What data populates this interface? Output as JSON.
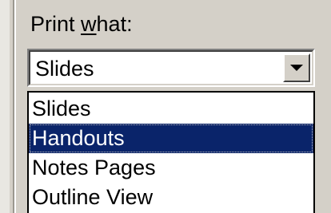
{
  "label": {
    "before": "Print ",
    "accel": "w",
    "after": "hat:"
  },
  "combo": {
    "selected_value": "Slides",
    "button_icon": "chevron-down-icon"
  },
  "dropdown": {
    "items": [
      {
        "label": "Slides",
        "selected": false
      },
      {
        "label": "Handouts",
        "selected": true
      },
      {
        "label": "Notes Pages",
        "selected": false
      },
      {
        "label": "Outline View",
        "selected": false
      }
    ]
  },
  "colors": {
    "dialog_bg": "#d4d0c8",
    "selection_bg": "#0a246a",
    "selection_text": "#ffffff"
  }
}
